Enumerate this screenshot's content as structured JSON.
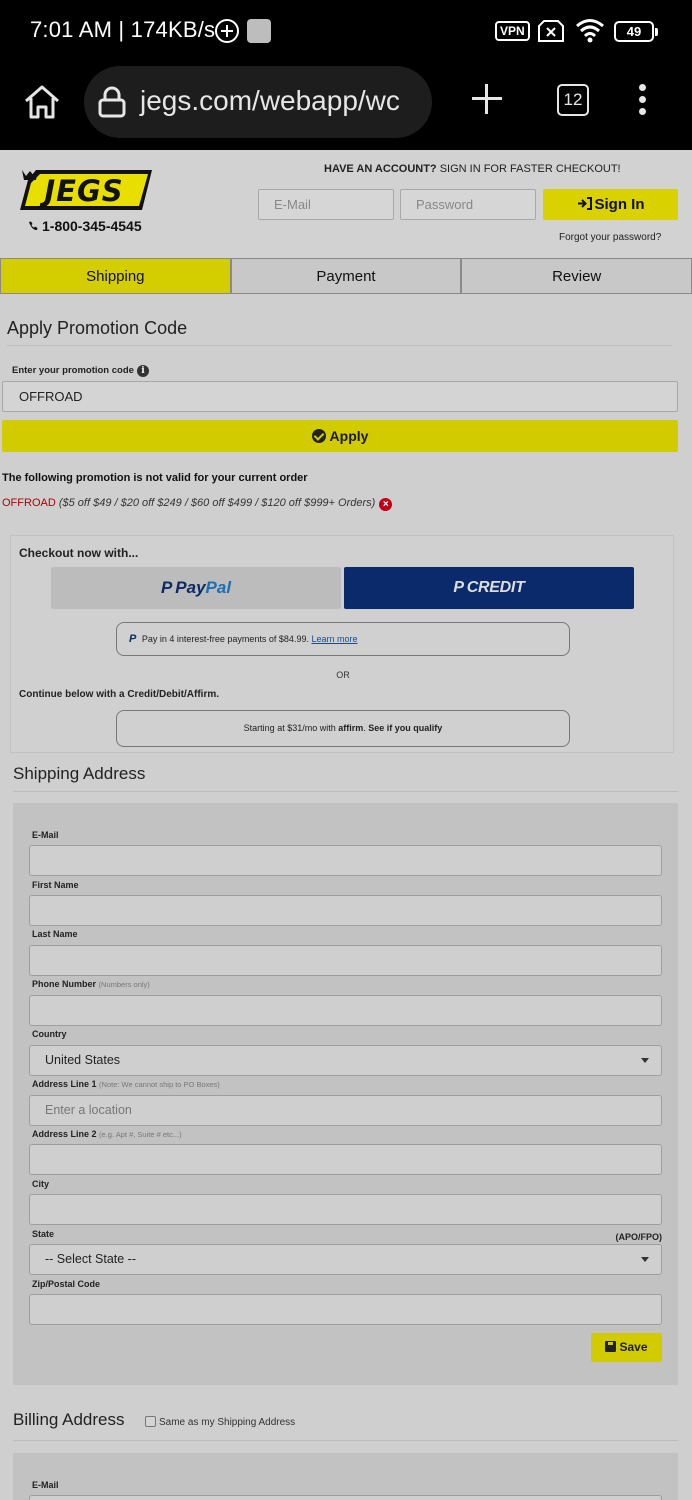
{
  "status_bar": {
    "time": "7:01 AM | 174KB/s",
    "vpn": "VPN",
    "battery": "49"
  },
  "browser": {
    "url": "jegs.com/webapp/wc",
    "tab_count": "12"
  },
  "header": {
    "logo_text": "JEGS",
    "phone": "1-800-345-4545",
    "account_prompt_bold": "HAVE AN ACCOUNT?",
    "account_prompt": " SIGN IN FOR FASTER CHECKOUT!",
    "email_placeholder": "E-Mail",
    "password_placeholder": "Password",
    "sign_in_label": "Sign In",
    "forgot_password": "Forgot your password?"
  },
  "steps": [
    {
      "label": "Shipping",
      "active": true
    },
    {
      "label": "Payment",
      "active": false
    },
    {
      "label": "Review",
      "active": false
    }
  ],
  "promo": {
    "title": "Apply Promotion Code",
    "label": "Enter your promotion code",
    "value": "OFFROAD",
    "apply_label": "Apply",
    "error_message": "The following promotion is not valid for your current order",
    "code": "OFFROAD",
    "description": " ($5 off $49 / $20 off $249 / $60 off $499 / $120 off $999+ Orders)"
  },
  "express_checkout": {
    "title": "Checkout now with...",
    "paypal_label_1": "Pay",
    "paypal_label_2": "Pal",
    "credit_label": "CREDIT",
    "pay_in_4": "Pay in 4 interest-free payments of $84.99.",
    "learn_more": "Learn more",
    "or": "OR",
    "continue_text": "Continue below with a Credit/Debit/Affirm.",
    "affirm_prefix": "Starting at $31/mo with",
    "affirm_logo": "affirm",
    "affirm_link": "See if you qualify"
  },
  "shipping": {
    "title": "Shipping Address",
    "fields": {
      "email": {
        "label": "E-Mail",
        "value": ""
      },
      "first_name": {
        "label": "First Name",
        "value": ""
      },
      "last_name": {
        "label": "Last Name",
        "value": ""
      },
      "phone": {
        "label": "Phone Number",
        "note": "(Numbers only)",
        "value": ""
      },
      "country": {
        "label": "Country",
        "value": "United States"
      },
      "address1": {
        "label": "Address Line 1",
        "note": "(Note: We cannot ship to PO Boxes)",
        "placeholder": "Enter a location"
      },
      "address2": {
        "label": "Address Line 2",
        "note": "(e.g. Apt #, Suite # etc...)",
        "value": ""
      },
      "city": {
        "label": "City",
        "value": ""
      },
      "state": {
        "label": "State",
        "aside": "(APO/FPO)",
        "value": "-- Select State --"
      },
      "zip": {
        "label": "Zip/Postal Code",
        "value": ""
      }
    },
    "save_label": "Save"
  },
  "billing": {
    "title": "Billing Address",
    "same_as_label": "Same as my Shipping Address",
    "email_label": "E-Mail"
  },
  "colors": {
    "brand_yellow": "#d2cb00",
    "paypal_credit": "#0b2a6b",
    "error_red": "#b10000"
  }
}
